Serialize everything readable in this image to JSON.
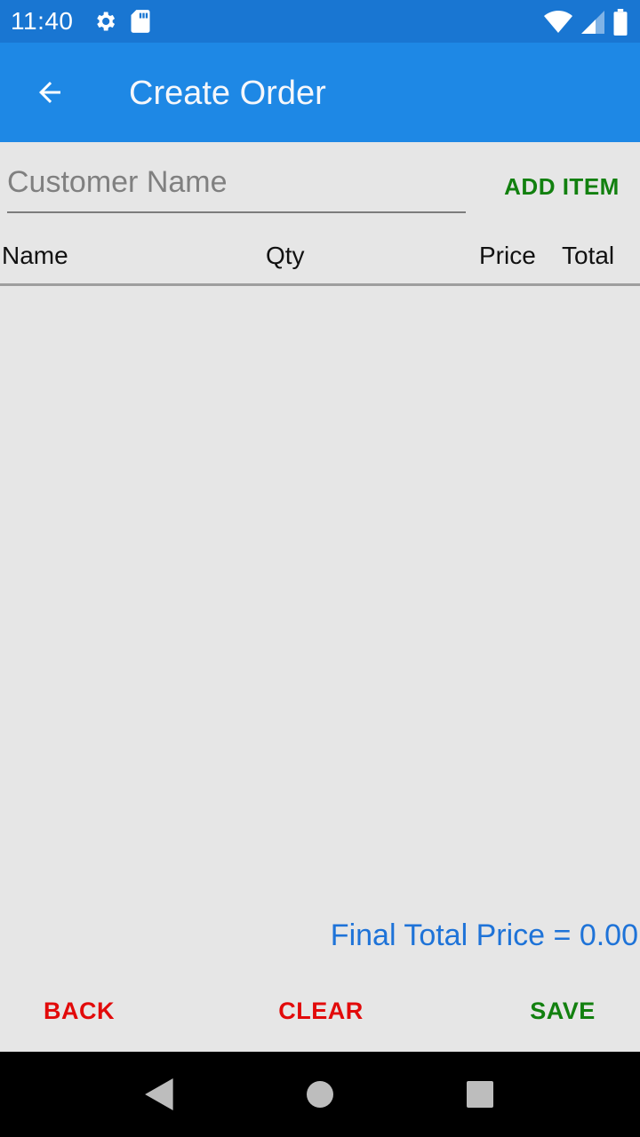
{
  "status_bar": {
    "time": "11:40",
    "left_icons": [
      "settings-icon",
      "sd-card-icon"
    ],
    "right_icons": [
      "wifi-icon",
      "cell-signal-icon",
      "battery-icon"
    ]
  },
  "app_bar": {
    "title": "Create Order",
    "back_icon": "arrow-left-icon"
  },
  "form": {
    "customer_name": {
      "value": "",
      "placeholder": "Customer Name"
    },
    "add_item_label": "ADD ITEM"
  },
  "table": {
    "columns": [
      "Name",
      "Qty",
      "Price",
      "Total"
    ],
    "rows": []
  },
  "summary": {
    "final_total_label": "Final Total Price = ",
    "final_total_value": "0.00"
  },
  "actions": {
    "back_label": "BACK",
    "clear_label": "CLEAR",
    "save_label": "SAVE"
  },
  "nav_bar": {
    "buttons": [
      "back-triangle-icon",
      "home-circle-icon",
      "recents-square-icon"
    ]
  },
  "colors": {
    "status_bar": "#1976d2",
    "app_bar": "#1e88e5",
    "background": "#e6e6e6",
    "positive_action": "#12800f",
    "negative_action": "#e20a0a",
    "total_text": "#1e73d8"
  }
}
